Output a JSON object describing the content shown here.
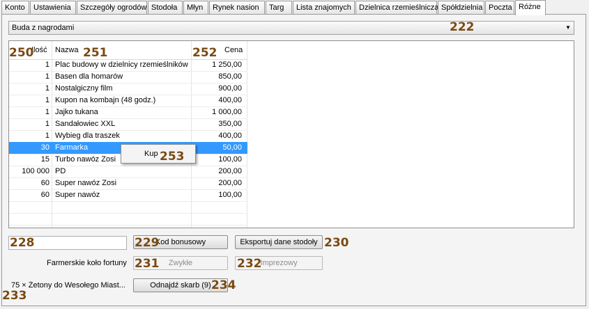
{
  "tabs": [
    "Konto",
    "Ustawienia",
    "Szczegóły ogrodów",
    "Stodoła",
    "Młyn",
    "Rynek nasion",
    "Targ",
    "Lista znajomych",
    "Dzielnica rzemieślnicza",
    "Spółdzielnia",
    "Poczta",
    "Różne"
  ],
  "active_tab": "Różne",
  "dropdown": {
    "value": "Buda z nagrodami"
  },
  "table": {
    "columns": {
      "qty": "Ilość",
      "name": "Nazwa",
      "price": "Cena"
    },
    "rows": [
      {
        "qty": "1",
        "name": "Plac budowy w dzielnicy rzemieślników",
        "price": "1 250,00"
      },
      {
        "qty": "1",
        "name": "Basen dla homarów",
        "price": "850,00"
      },
      {
        "qty": "1",
        "name": "Nostalgiczny film",
        "price": "900,00"
      },
      {
        "qty": "1",
        "name": "Kupon na kombajn (48 godz.)",
        "price": "400,00"
      },
      {
        "qty": "1",
        "name": "Jajko tukana",
        "price": "1 000,00"
      },
      {
        "qty": "1",
        "name": "Sandałowiec XXL",
        "price": "350,00"
      },
      {
        "qty": "1",
        "name": "Wybieg dla traszek",
        "price": "400,00"
      },
      {
        "qty": "30",
        "name": "Farmarka",
        "price": "50,00"
      },
      {
        "qty": "15",
        "name": "Turbo nawóz Zosi",
        "price": "100,00"
      },
      {
        "qty": "100 000",
        "name": "PD",
        "price": "200,00"
      },
      {
        "qty": "60",
        "name": "Super nawóz Zosi",
        "price": "200,00"
      },
      {
        "qty": "60",
        "name": "Super nawóz",
        "price": "100,00"
      }
    ],
    "selected_row": 8
  },
  "context_menu": {
    "item": "Kup"
  },
  "bonus": {
    "input_value": "",
    "button": "Kod bonusowy"
  },
  "export_button": "Eksportuj dane stodoły",
  "fortune": {
    "label": "Farmerskie koło fortuny",
    "normal": "Zwykłe",
    "party": "Imprezowy"
  },
  "tokens_label": "75 × Żetony do Wesołego Miast...",
  "treasure_button": "Odnajdź skarb (9)",
  "annotations": {
    "a222": "222",
    "a250": "250",
    "a251": "251",
    "a252": "252",
    "a253": "253",
    "a228": "228",
    "a229": "229",
    "a230": "230",
    "a231": "231",
    "a232": "232",
    "a233": "233",
    "a234": "234"
  }
}
